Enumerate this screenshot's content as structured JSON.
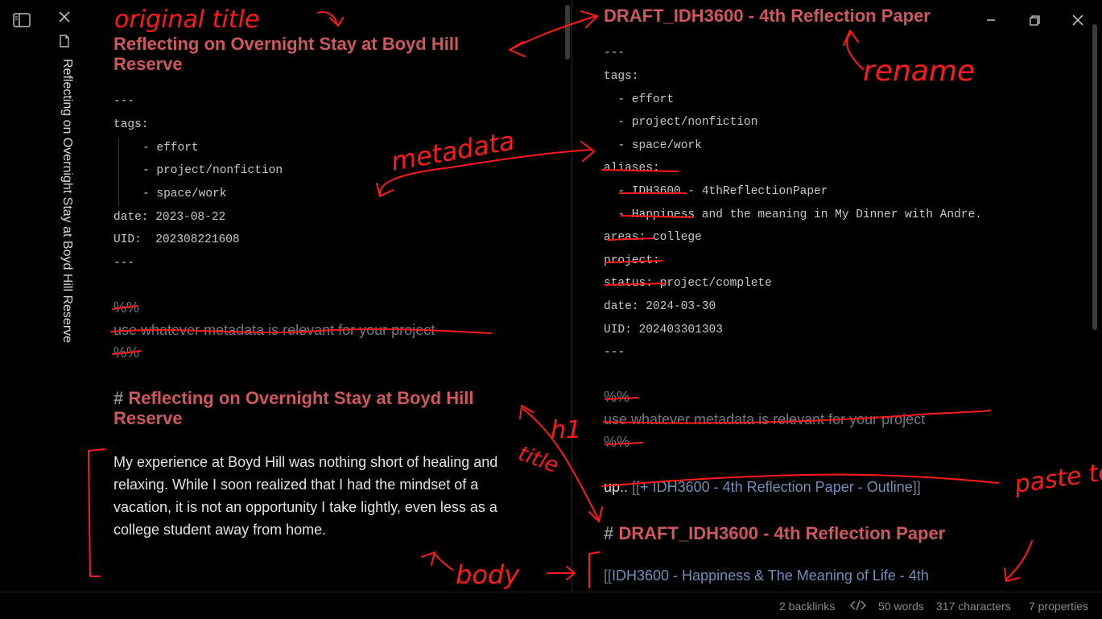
{
  "sidebar": {
    "toggle_icon": "sidebar-panel-icon",
    "close_icon": "close-icon",
    "file_icon": "file-icon",
    "vertical_tab_title": "Reflecting on Overnight Stay at Boyd Hill Reserve"
  },
  "left_pane": {
    "inline_title_line1": "Reflecting on Overnight Stay at Boyd Hill",
    "inline_title_line2": "Reserve",
    "fm_open": "---",
    "fm_tags": "tags:",
    "tag1": "- effort",
    "tag2": "- project/nonfiction",
    "tag3": "- space/work",
    "date": "date: 2023-08-22",
    "uid": "UID:  202308221608",
    "fm_close": "---",
    "comment_open": "%%",
    "comment_text": "use whatever metadata is relevant for your project",
    "comment_close": "%%",
    "h1_hash": "#",
    "h1_line1": "Reflecting on Overnight Stay at Boyd Hill",
    "h1_line2": "Reserve",
    "body": "My experience at Boyd Hill was nothing short of healing and relaxing. While I soon realized that I had the mindset of a vacation, it is not an opportunity I take lightly, even less as a college student away from home."
  },
  "right_pane": {
    "inline_title": "DRAFT_IDH3600 - 4th Reflection Paper",
    "fm_open": "---",
    "fm_tags": "tags:",
    "tag1": "  - effort",
    "tag2": "  - project/nonfiction",
    "tag3": "  - space/work",
    "aliases": "aliases:",
    "alias1": "  - IDH3600 - 4thReflectionPaper",
    "alias2": "  - Happiness and the meaning in My Dinner with Andre.",
    "areas": "areas: college",
    "project": "project:",
    "status": "status: project/complete",
    "date": "date: 2024-03-30",
    "uid": "UID: 202403301303",
    "fm_close": "---",
    "comment_open": "%%",
    "comment_text": "use whatever metadata is relevant for your project",
    "comment_close": "%%",
    "up_label": "up::",
    "up_open": "[[",
    "up_link": "+ IDH3600 - 4th Reflection Paper - Outline",
    "up_close": "]]",
    "h1_hash": "#",
    "h1_text": "DRAFT_IDH3600 - 4th Reflection Paper",
    "body_open": "[[",
    "body_link": "IDH3600 - Happiness & The Meaning of Life - 4th"
  },
  "window_controls": {
    "minimize_icon": "minimize-icon",
    "restore_icon": "restore-icon",
    "close_icon": "close-icon"
  },
  "status_bar": {
    "backlinks": "2 backlinks",
    "code_icon": "code-icon",
    "words": "50 words",
    "characters": "317 characters",
    "properties": "7 properties"
  },
  "annotations": {
    "original_title": "original title",
    "rename": "rename",
    "metadata": "metadata",
    "h1": "h1",
    "title": "title",
    "body": "body",
    "paste_text": "paste text"
  },
  "colors": {
    "background": "#000000",
    "title_red": "#d0575c",
    "link_blue": "#6f8fb8",
    "annotation_red": "#ff1a1a"
  }
}
